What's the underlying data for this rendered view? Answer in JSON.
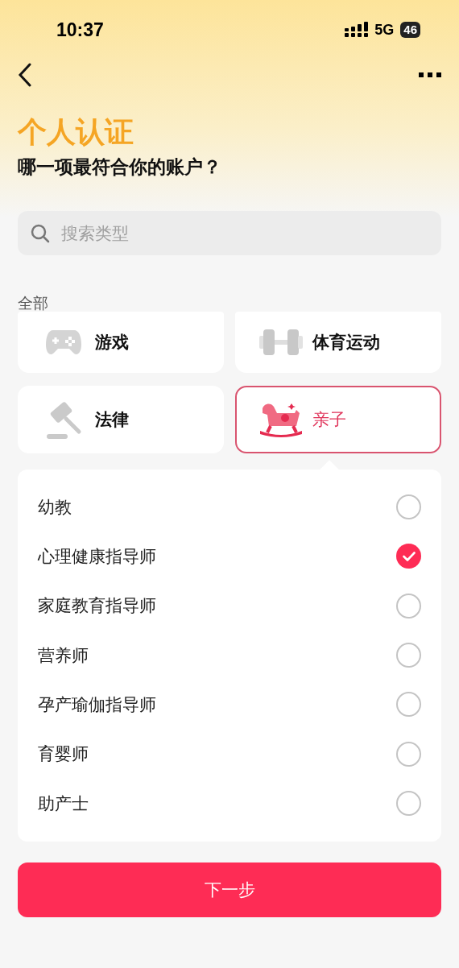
{
  "status_bar": {
    "time": "10:37",
    "network": "5G",
    "battery": "46"
  },
  "title": "个人认证",
  "subtitle": "哪一项最符合你的账户？",
  "search": {
    "placeholder": "搜索类型"
  },
  "section_label": "全部",
  "categories": [
    {
      "label": "游戏",
      "kind": "gamepad",
      "selected": false
    },
    {
      "label": "体育运动",
      "kind": "dumbbell",
      "selected": false
    },
    {
      "label": "法律",
      "kind": "gavel",
      "selected": false
    },
    {
      "label": "亲子",
      "kind": "rocking-horse",
      "selected": true
    }
  ],
  "options": [
    {
      "label": "幼教",
      "checked": false
    },
    {
      "label": "心理健康指导师",
      "checked": true
    },
    {
      "label": "家庭教育指导师",
      "checked": false
    },
    {
      "label": "营养师",
      "checked": false
    },
    {
      "label": "孕产瑜伽指导师",
      "checked": false
    },
    {
      "label": "育婴师",
      "checked": false
    },
    {
      "label": "助产士",
      "checked": false
    }
  ],
  "next_button": "下一步"
}
